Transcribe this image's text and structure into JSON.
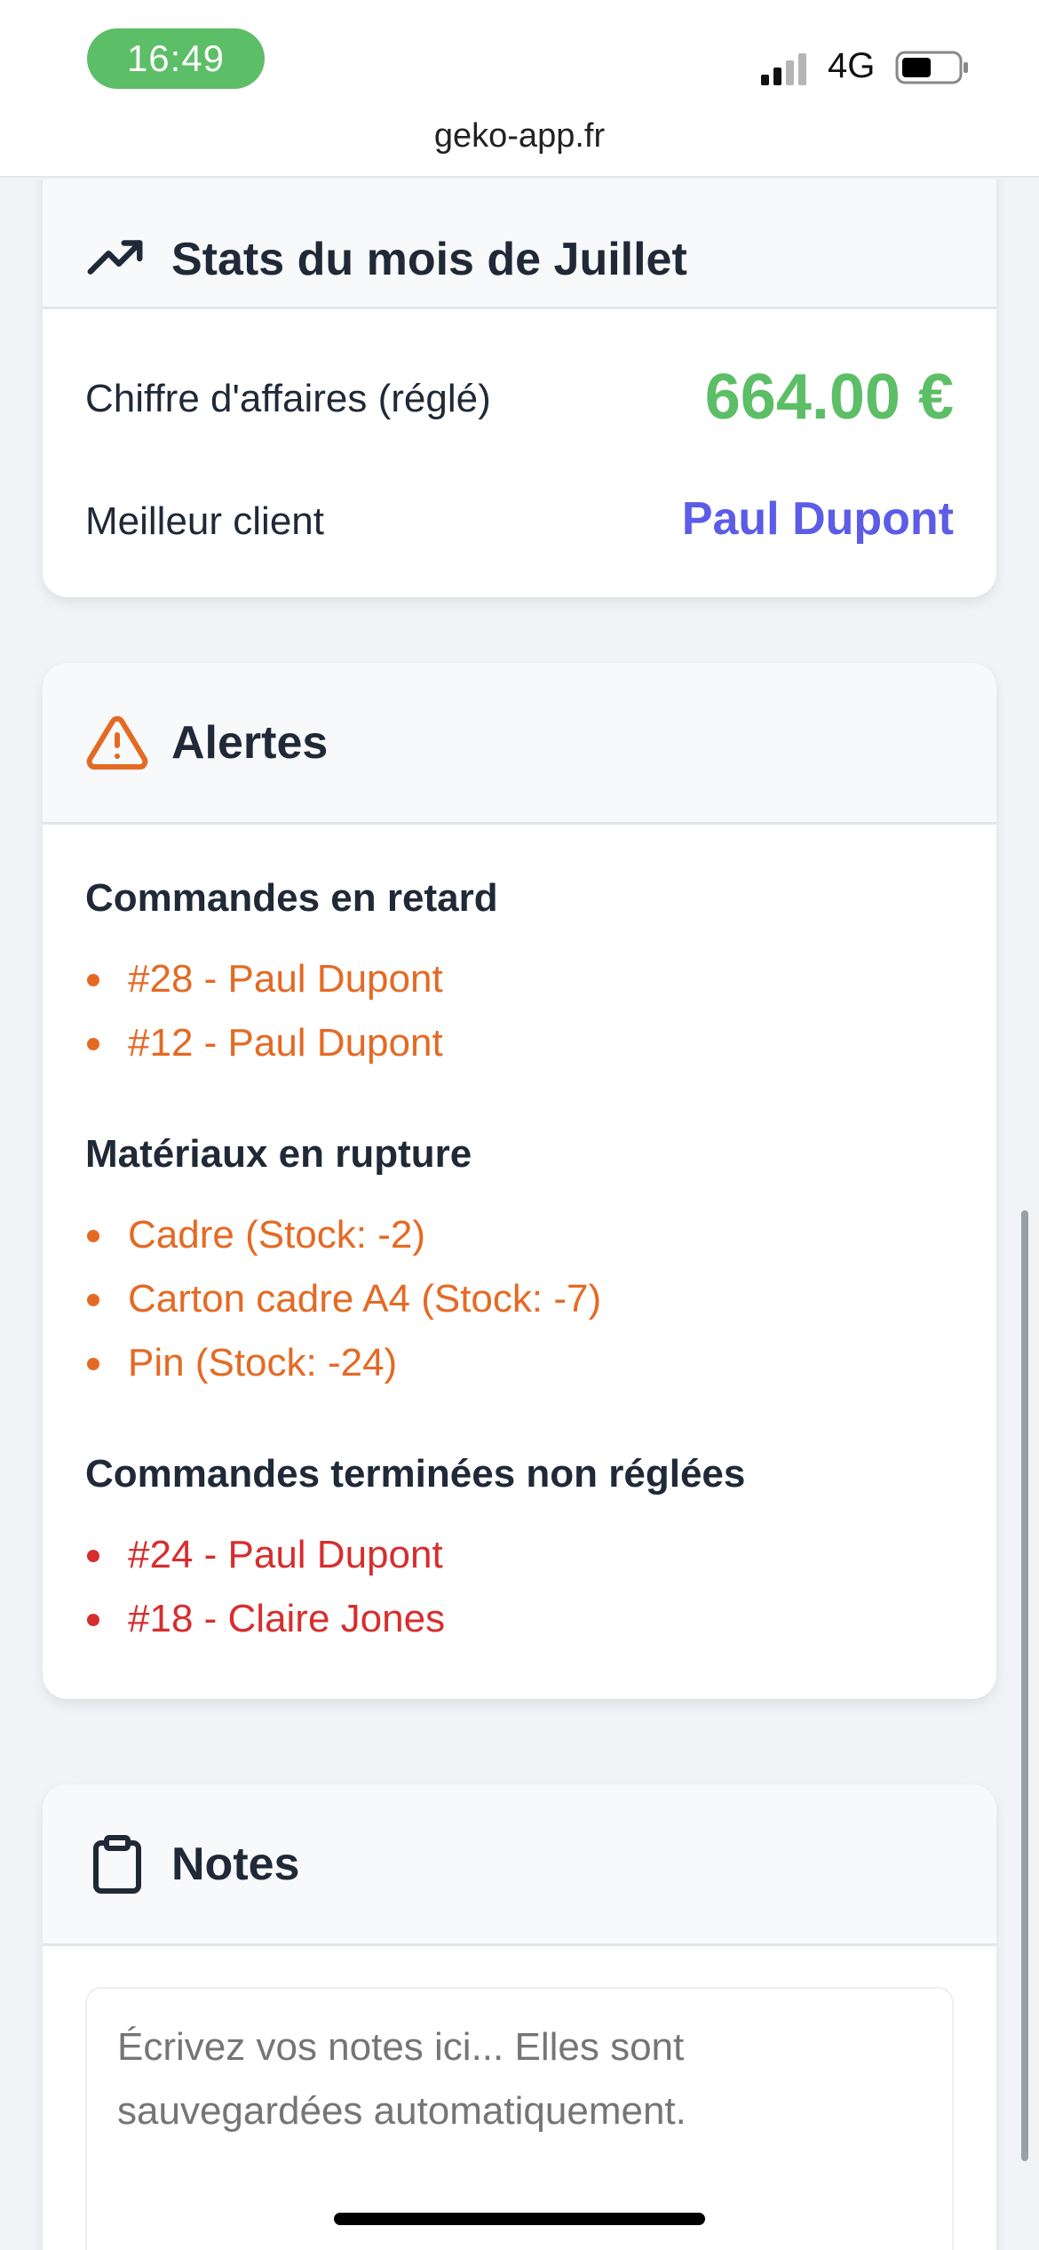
{
  "status_bar": {
    "time": "16:49",
    "network": "4G",
    "url": "geko-app.fr"
  },
  "stats": {
    "title": "Stats du mois de Juillet",
    "icon": "trending-up-icon",
    "revenue_label": "Chiffre d'affaires (réglé)",
    "revenue_value": "664.00 €",
    "best_client_label": "Meilleur client",
    "best_client_value": "Paul Dupont"
  },
  "alerts": {
    "title": "Alertes",
    "icon": "warning-triangle-icon",
    "late_orders": {
      "title": "Commandes en retard",
      "items": [
        "#28 - Paul Dupont",
        "#12 - Paul Dupont"
      ]
    },
    "out_of_stock": {
      "title": "Matériaux en rupture",
      "items": [
        "Cadre (Stock: -2)",
        "Carton cadre A4 (Stock: -7)",
        "Pin (Stock: -24)"
      ]
    },
    "unpaid": {
      "title": "Commandes terminées non réglées",
      "items": [
        "#24 - Paul Dupont",
        "#18 - Claire Jones"
      ]
    }
  },
  "notes": {
    "title": "Notes",
    "icon": "clipboard-icon",
    "placeholder": "Écrivez vos notes ici... Elles sont sauvegardées automatiquement."
  },
  "colors": {
    "green": "#5cbe66",
    "accent": "#5c5ce6",
    "orange": "#e46a24",
    "red": "#d62e2e"
  }
}
